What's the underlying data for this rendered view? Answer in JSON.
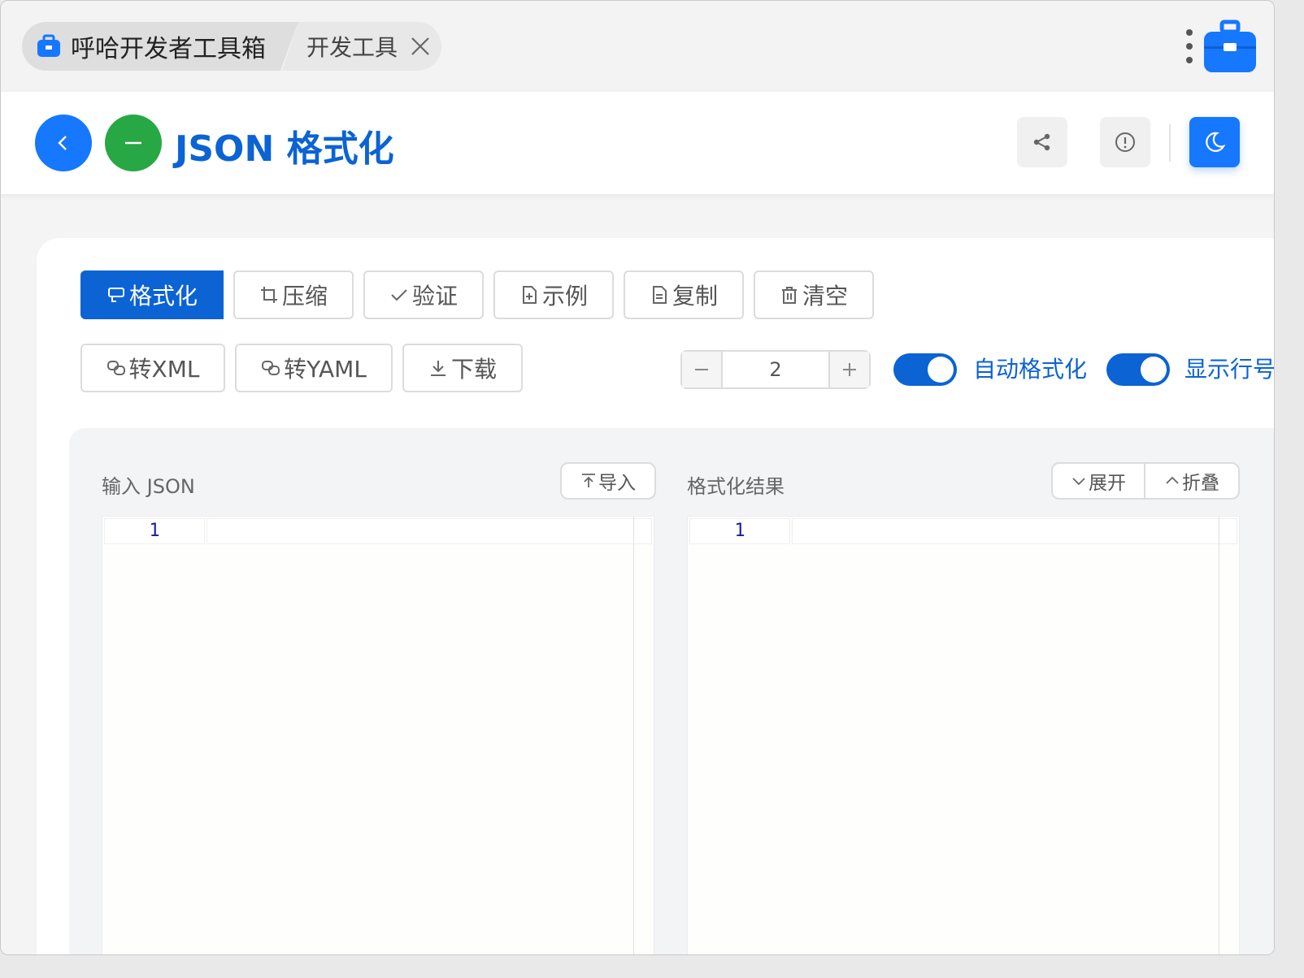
{
  "tabs": {
    "main_title": "呼哈开发者工具箱",
    "sub_title": "开发工具"
  },
  "header": {
    "title": "JSON 格式化"
  },
  "toolbar": {
    "row1": [
      {
        "label": "格式化",
        "icon": "format-icon"
      },
      {
        "label": "压缩",
        "icon": "crop-icon"
      },
      {
        "label": "验证",
        "icon": "check-icon"
      },
      {
        "label": "示例",
        "icon": "file-plus-icon"
      },
      {
        "label": "复制",
        "icon": "document-icon"
      },
      {
        "label": "清空",
        "icon": "trash-icon"
      }
    ],
    "row2": [
      {
        "label": "转XML",
        "icon": "convert-icon"
      },
      {
        "label": "转YAML",
        "icon": "convert-icon"
      },
      {
        "label": "下载",
        "icon": "download-icon"
      }
    ],
    "indent_value": "2",
    "auto_format_label": "自动格式化",
    "show_line_numbers_label": "显示行号",
    "auto_format_on": true,
    "show_line_numbers_on": true
  },
  "input_panel": {
    "label": "输入 JSON",
    "import_label": "导入",
    "line_number": "1"
  },
  "output_panel": {
    "label": "格式化结果",
    "expand_label": "展开",
    "collapse_label": "折叠",
    "line_number": "1"
  },
  "colors": {
    "primary": "#0b63d4",
    "accent_blue": "#1677ff",
    "green": "#28a745"
  }
}
